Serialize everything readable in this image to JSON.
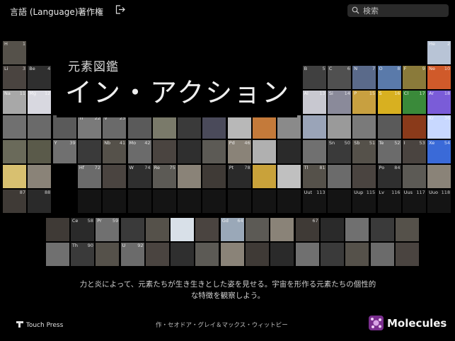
{
  "topbar": {
    "language": "言語 (Language)",
    "credits": "著作権",
    "search_placeholder": "検索"
  },
  "header": {
    "subtitle": "元素図鑑",
    "title": "イン・アクション"
  },
  "tagline": {
    "line1": "力と炎によって、元素たちが生き生きとした姿を見せる。宇宙を形作る元素たちの個性的",
    "line2": "な特徴を観察しよう。"
  },
  "footer": {
    "publisher": "Touch Press",
    "authors": "作・セオドア・グレイ＆マックス・ウィットビー",
    "app": "Molecules"
  },
  "visible_cells": [
    {
      "n": "1",
      "s": "H"
    },
    {
      "n": "2",
      "s": "He"
    },
    {
      "n": "3",
      "s": "Li"
    },
    {
      "n": "4",
      "s": "Be"
    },
    {
      "n": "5",
      "s": "B"
    },
    {
      "n": "6",
      "s": "C"
    },
    {
      "n": "7",
      "s": "N"
    },
    {
      "n": "8",
      "s": "O"
    },
    {
      "n": "9",
      "s": "F"
    },
    {
      "n": "10",
      "s": "Ne"
    },
    {
      "n": "11",
      "s": "Na"
    },
    {
      "n": "12",
      "s": "Mg"
    },
    {
      "n": "13",
      "s": "Al"
    },
    {
      "n": "14",
      "s": "Si"
    },
    {
      "n": "15",
      "s": "P"
    },
    {
      "n": "16",
      "s": "S"
    },
    {
      "n": "17",
      "s": "Cl"
    },
    {
      "n": "18",
      "s": "Ar"
    },
    {
      "n": "22",
      "s": "Ti"
    },
    {
      "n": "23",
      "s": "V"
    },
    {
      "n": "36",
      "s": "Kr"
    },
    {
      "n": "39",
      "s": "Y"
    },
    {
      "n": "41",
      "s": "Nb"
    },
    {
      "n": "42",
      "s": "Mo"
    },
    {
      "n": "46",
      "s": "Pd"
    },
    {
      "n": "50",
      "s": "Sn"
    },
    {
      "n": "51",
      "s": "Sb"
    },
    {
      "n": "52",
      "s": "Te"
    },
    {
      "n": "53",
      "s": "I"
    },
    {
      "n": "54",
      "s": "Xe"
    },
    {
      "n": "72",
      "s": "Hf"
    },
    {
      "n": "74",
      "s": "W"
    },
    {
      "n": "75",
      "s": "Re"
    },
    {
      "n": "78",
      "s": "Pt"
    },
    {
      "n": "81",
      "s": "Tl"
    },
    {
      "n": "84",
      "s": "Po"
    },
    {
      "n": "87",
      "s": ""
    },
    {
      "n": "88",
      "s": ""
    },
    {
      "n": "113",
      "s": "Uut"
    },
    {
      "n": "115",
      "s": "Uup"
    },
    {
      "n": "116",
      "s": "Lv"
    },
    {
      "n": "117",
      "s": "Uus"
    },
    {
      "n": "118",
      "s": "Uuo"
    },
    {
      "n": "58",
      "s": "Ce"
    },
    {
      "n": "59",
      "s": "Pr"
    },
    {
      "n": "64",
      "s": "Gd"
    },
    {
      "n": "67",
      "s": ""
    },
    {
      "n": "90",
      "s": "Th"
    },
    {
      "n": "92",
      "s": "U"
    }
  ],
  "colors": {
    "background": "#000000",
    "molecules_brand": "#7a2e8e"
  },
  "icons": {
    "logout": "logout-icon",
    "search": "search-icon",
    "publisher_logo": "touch-press-logo-icon",
    "app_logo": "molecules-logo-icon"
  }
}
